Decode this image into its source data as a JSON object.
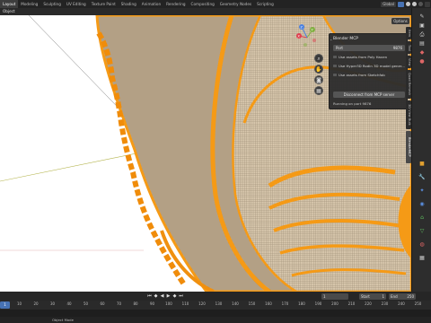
{
  "topbar": {
    "tabs": [
      "Layout",
      "Modeling",
      "Sculpting",
      "UV Editing",
      "Texture Paint",
      "Shading",
      "Animation",
      "Rendering",
      "Compositing",
      "Geometry Nodes",
      "Scripting"
    ],
    "orientation_label": "Global"
  },
  "header": {
    "object_label": "Object"
  },
  "viewport": {
    "options_label": "Options",
    "gizmo_axes": [
      "X",
      "Y",
      "Z"
    ]
  },
  "mcp_panel": {
    "title": "Blender MCP",
    "port_label": "Port",
    "port_value": "9876",
    "checkboxes": [
      "Use assets from Poly Haven",
      "Use Hyper3D Rodin 3D model gener...",
      "Use assets from Sketchfab"
    ],
    "disconnect_label": "Disconnect from MCP server",
    "status": "Running on port 9876"
  },
  "sidebar_tabs": [
    "Item",
    "Tool",
    "View",
    "Quad Remesh",
    "3D View Bulk",
    "BlenderMCP"
  ],
  "timeline": {
    "current_frame": "1",
    "start_label": "Start",
    "start_value": "1",
    "end_label": "End",
    "end_value": "250",
    "ruler_ticks": [
      "0",
      "10",
      "20",
      "30",
      "40",
      "50",
      "60",
      "70",
      "80",
      "90",
      "100",
      "110",
      "120",
      "130",
      "140",
      "150",
      "160",
      "170",
      "180",
      "190",
      "200",
      "210",
      "220",
      "230",
      "240",
      "250"
    ]
  },
  "statusbar": {
    "text": "Object Mode"
  },
  "colors": {
    "accent": "#4772b3",
    "selection_orange": "#f5a01e",
    "background_white": "#ffffff"
  }
}
